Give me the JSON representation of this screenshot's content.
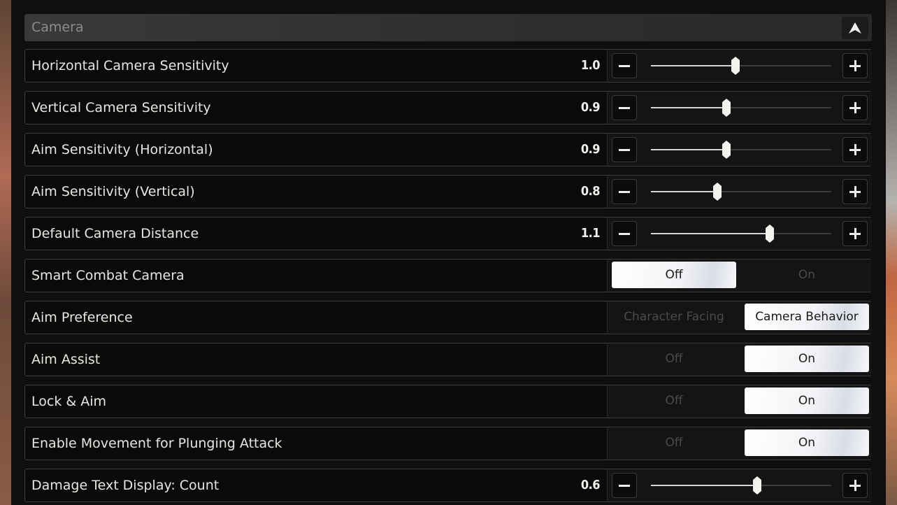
{
  "section": {
    "title": "Camera",
    "collapse_icon": "chevron-up-icon"
  },
  "sliders": [
    {
      "id": "horizontal-camera-sensitivity",
      "label": "Horizontal Camera Sensitivity",
      "value": "1.0",
      "fraction": 0.47
    },
    {
      "id": "vertical-camera-sensitivity",
      "label": "Vertical Camera Sensitivity",
      "value": "0.9",
      "fraction": 0.42
    },
    {
      "id": "aim-sensitivity-horizontal",
      "label": "Aim Sensitivity (Horizontal)",
      "value": "0.9",
      "fraction": 0.42
    },
    {
      "id": "aim-sensitivity-vertical",
      "label": "Aim Sensitivity (Vertical)",
      "value": "0.8",
      "fraction": 0.37
    },
    {
      "id": "default-camera-distance",
      "label": "Default Camera Distance",
      "value": "1.1",
      "fraction": 0.66
    },
    {
      "id": "damage-text-display-count",
      "label": "Damage Text Display: Count",
      "value": "0.6",
      "fraction": 0.59
    }
  ],
  "toggles": [
    {
      "id": "smart-combat-camera",
      "label": "Smart Combat Camera",
      "options": [
        "Off",
        "On"
      ],
      "selected": 0
    },
    {
      "id": "aim-preference",
      "label": "Aim Preference",
      "options": [
        "Character Facing",
        "Camera Behavior"
      ],
      "selected": 1
    },
    {
      "id": "aim-assist",
      "label": "Aim Assist",
      "options": [
        "Off",
        "On"
      ],
      "selected": 1
    },
    {
      "id": "lock-and-aim",
      "label": "Lock & Aim",
      "options": [
        "Off",
        "On"
      ],
      "selected": 1
    },
    {
      "id": "enable-movement-plunging-attack",
      "label": "Enable Movement for Plunging Attack",
      "options": [
        "Off",
        "On"
      ],
      "selected": 1
    }
  ],
  "colors": {
    "panel": "#0e0d0d",
    "text": "#e9e6e1",
    "selected_bg": "#f2f3f6",
    "unselected_text": "#4b4a48"
  }
}
